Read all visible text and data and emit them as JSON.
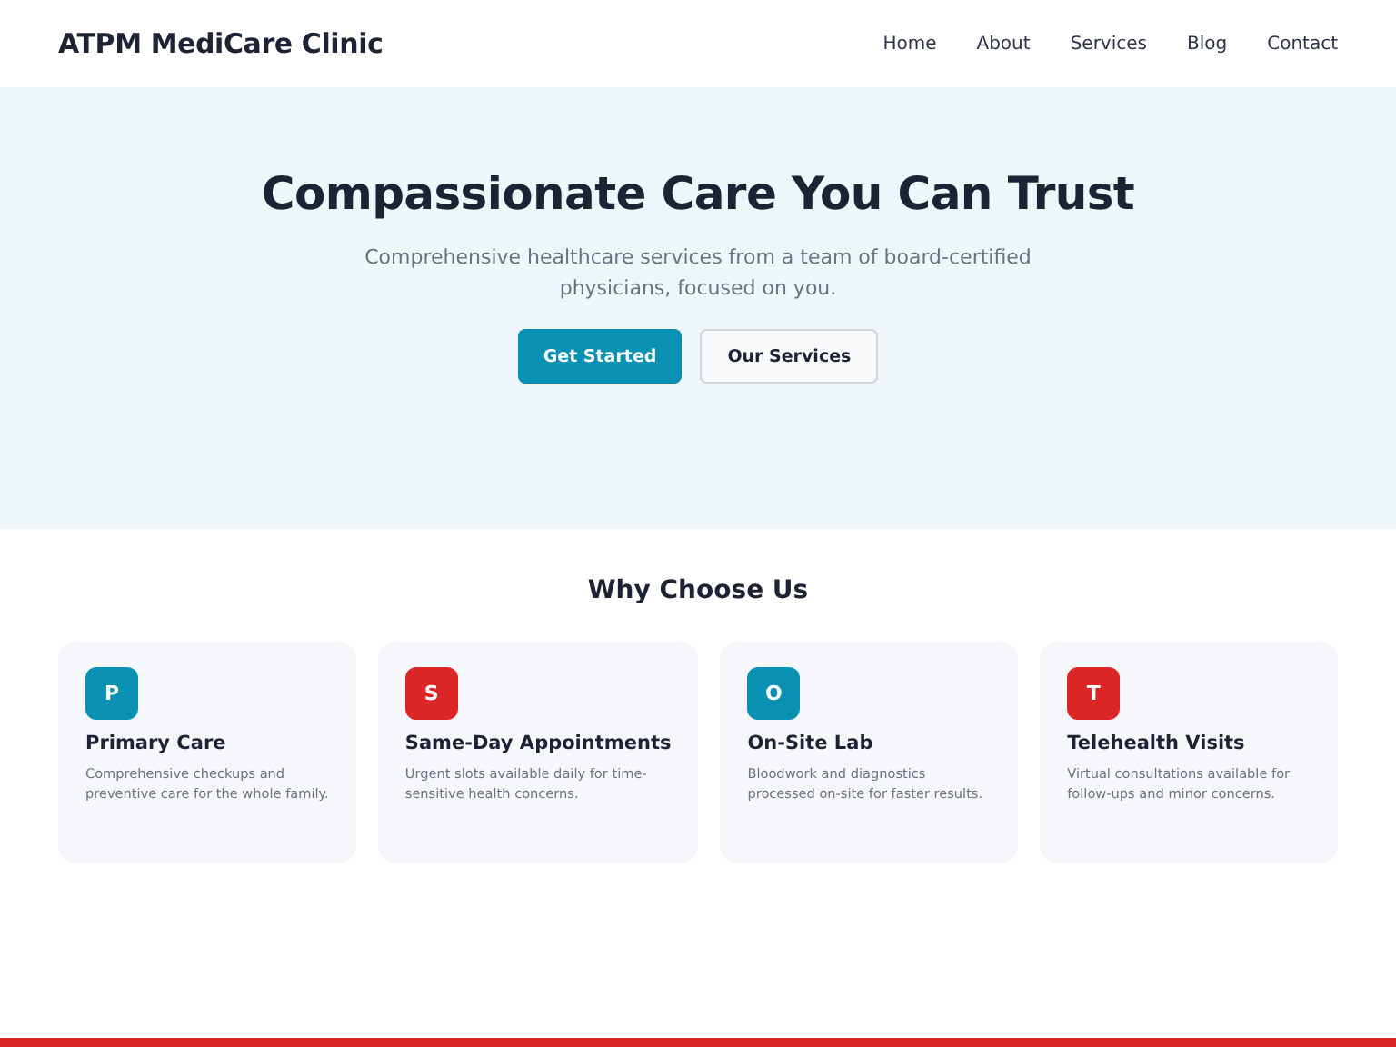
{
  "header": {
    "brand": "ATPM MediCare Clinic",
    "nav": [
      "Home",
      "About",
      "Services",
      "Blog",
      "Contact"
    ]
  },
  "hero": {
    "title": "Compassionate Care You Can Trust",
    "subtitle": "Comprehensive healthcare services from a team of board-certified physicians, focused on you.",
    "buttons": [
      {
        "label": "Get Started",
        "kind": "primary"
      },
      {
        "label": "Our Services",
        "kind": "secondary"
      }
    ]
  },
  "features": {
    "title": "Why Choose Us",
    "cards": [
      {
        "initial": "P",
        "color": "#0891b2",
        "title": "Primary Care",
        "text": "Comprehensive checkups and preventive care for the whole family."
      },
      {
        "initial": "S",
        "color": "#dc2626",
        "title": "Same-Day Appointments",
        "text": "Urgent slots available daily for time-sensitive health concerns."
      },
      {
        "initial": "O",
        "color": "#0891b2",
        "title": "On-Site Lab",
        "text": "Bloodwork and diagnostics processed on-site for faster results."
      },
      {
        "initial": "T",
        "color": "#dc2626",
        "title": "Telehealth Visits",
        "text": "Virtual consultations available for follow-ups and minor concerns."
      }
    ]
  }
}
